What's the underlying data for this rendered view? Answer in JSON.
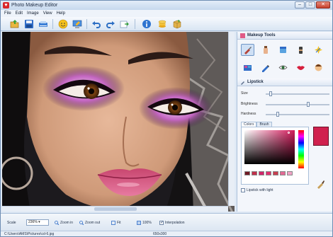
{
  "window": {
    "title": "Photo Makeup Editor",
    "minimize": "–",
    "maximize": "□",
    "close": "✕"
  },
  "menu": [
    "File",
    "Edit",
    "Image",
    "View",
    "Help"
  ],
  "panel": {
    "makeup_tools_title": "Makeup Tools",
    "lipstick_title": "Lipstick",
    "sliders": [
      {
        "label": "Size",
        "value": 0.06
      },
      {
        "label": "Brightness",
        "value": 0.68
      },
      {
        "label": "Hardness",
        "value": 0.18
      }
    ],
    "tabs": [
      "Colors",
      "Brush"
    ],
    "selected_color": "#d0214e",
    "swatch_colors": [
      "#6e1a24",
      "#c2304a",
      "#d1266a",
      "#e1306f",
      "#c8404f",
      "#e46a94",
      "#f0a2c5"
    ],
    "lipstick_with_light": "Lipstick with light"
  },
  "bottom": {
    "scale_label": "Scale",
    "scale_value": "236%",
    "zoom_in": "Zoom in",
    "zoom_out": "Zoom out",
    "fit": "Fit",
    "hundred": "100%",
    "interpolation": "Interpolation"
  },
  "status": {
    "path": "C:\\Users\\AMS\\Pictures\\cd-6.jpg",
    "dimensions": "650x300"
  }
}
